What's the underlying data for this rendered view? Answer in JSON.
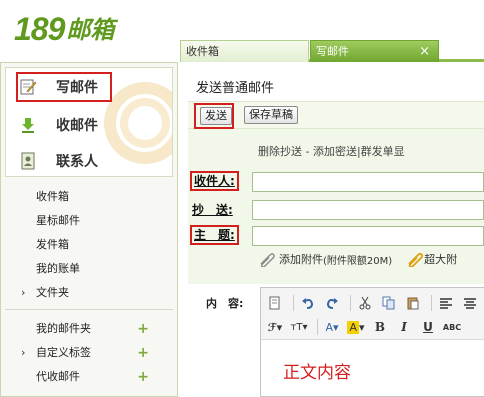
{
  "logo": {
    "number": "189",
    "name": "邮箱"
  },
  "tabs": [
    {
      "label": "收件箱"
    },
    {
      "label": "写邮件",
      "close": "×"
    }
  ],
  "sidebar": {
    "buttons": [
      {
        "label": "写邮件",
        "icon": "write-icon"
      },
      {
        "label": "收邮件",
        "icon": "download-icon"
      },
      {
        "label": "联系人",
        "icon": "contacts-icon"
      }
    ],
    "folders": [
      "收件箱",
      "星标邮件",
      "发件箱",
      "我的账单",
      "文件夹"
    ],
    "extras": [
      "我的邮件夹",
      "自定义标签",
      "代收邮件"
    ],
    "expand_arrow": "›",
    "add_symbol": "+"
  },
  "compose": {
    "title": "发送普通邮件",
    "send_label": "发送",
    "draft_label": "保存草稿",
    "links": {
      "remove_cc": "删除抄送",
      "sep1": " - ",
      "add_bcc": "添加密送",
      "sep2": "|",
      "mass_send": "群发单显"
    },
    "fields": {
      "to": "收件人",
      "cc": "抄　送",
      "subject": "主　题",
      "colon": ":"
    },
    "attach_label": "添加附件",
    "attach_limit": "(附件限额20M)",
    "big_attach_label": "超大附",
    "content_label": "内　容:",
    "body_text": "正文内容"
  },
  "colors": {
    "brand": "#5f9a1f",
    "highlight": "#d41f1f",
    "form_bg": "#f2f8e9"
  }
}
